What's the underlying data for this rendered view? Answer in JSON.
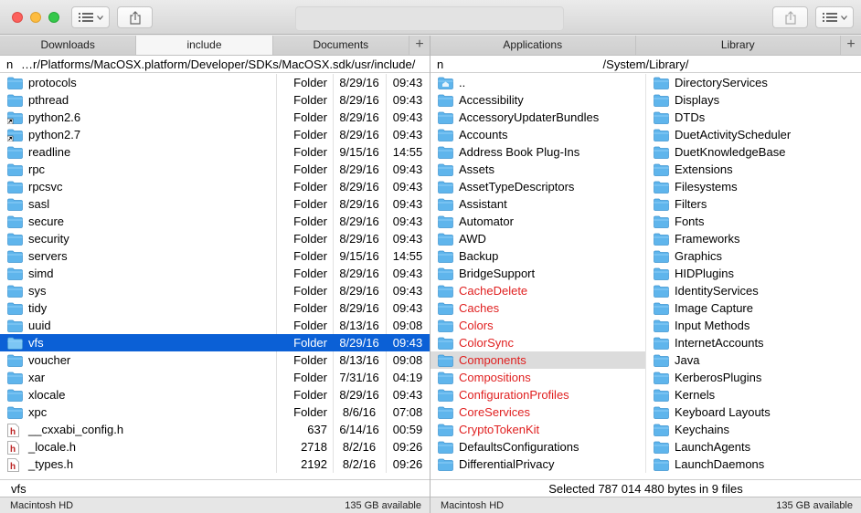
{
  "toolbar": {
    "list_view_icon": "list-view-icon",
    "share_icon": "share-icon"
  },
  "left": {
    "tabs": [
      {
        "label": "Downloads",
        "active": false
      },
      {
        "label": "include",
        "active": true
      },
      {
        "label": "Documents",
        "active": false
      }
    ],
    "add_tab": "+",
    "path_prefix": "n",
    "path": "…r/Platforms/MacOSX.platform/Developer/SDKs/MacOSX.sdk/usr/include/",
    "rows": [
      {
        "name": "protocols",
        "kind": "Folder",
        "date": "8/29/16",
        "time": "09:43",
        "icon": "folder"
      },
      {
        "name": "pthread",
        "kind": "Folder",
        "date": "8/29/16",
        "time": "09:43",
        "icon": "folder"
      },
      {
        "name": "python2.6",
        "kind": "Folder",
        "date": "8/29/16",
        "time": "09:43",
        "icon": "alias-folder"
      },
      {
        "name": "python2.7",
        "kind": "Folder",
        "date": "8/29/16",
        "time": "09:43",
        "icon": "alias-folder"
      },
      {
        "name": "readline",
        "kind": "Folder",
        "date": "9/15/16",
        "time": "14:55",
        "icon": "folder"
      },
      {
        "name": "rpc",
        "kind": "Folder",
        "date": "8/29/16",
        "time": "09:43",
        "icon": "folder"
      },
      {
        "name": "rpcsvc",
        "kind": "Folder",
        "date": "8/29/16",
        "time": "09:43",
        "icon": "folder"
      },
      {
        "name": "sasl",
        "kind": "Folder",
        "date": "8/29/16",
        "time": "09:43",
        "icon": "folder"
      },
      {
        "name": "secure",
        "kind": "Folder",
        "date": "8/29/16",
        "time": "09:43",
        "icon": "folder"
      },
      {
        "name": "security",
        "kind": "Folder",
        "date": "8/29/16",
        "time": "09:43",
        "icon": "folder"
      },
      {
        "name": "servers",
        "kind": "Folder",
        "date": "9/15/16",
        "time": "14:55",
        "icon": "folder"
      },
      {
        "name": "simd",
        "kind": "Folder",
        "date": "8/29/16",
        "time": "09:43",
        "icon": "folder"
      },
      {
        "name": "sys",
        "kind": "Folder",
        "date": "8/29/16",
        "time": "09:43",
        "icon": "folder"
      },
      {
        "name": "tidy",
        "kind": "Folder",
        "date": "8/29/16",
        "time": "09:43",
        "icon": "folder"
      },
      {
        "name": "uuid",
        "kind": "Folder",
        "date": "8/13/16",
        "time": "09:08",
        "icon": "folder"
      },
      {
        "name": "vfs",
        "kind": "Folder",
        "date": "8/29/16",
        "time": "09:43",
        "icon": "folder",
        "selected": true
      },
      {
        "name": "voucher",
        "kind": "Folder",
        "date": "8/13/16",
        "time": "09:08",
        "icon": "folder"
      },
      {
        "name": "xar",
        "kind": "Folder",
        "date": "7/31/16",
        "time": "04:19",
        "icon": "folder"
      },
      {
        "name": "xlocale",
        "kind": "Folder",
        "date": "8/29/16",
        "time": "09:43",
        "icon": "folder"
      },
      {
        "name": "xpc",
        "kind": "Folder",
        "date": "8/6/16",
        "time": "07:08",
        "icon": "folder"
      },
      {
        "name": "__cxxabi_config.h",
        "kind": "637",
        "date": "6/14/16",
        "time": "00:59",
        "icon": "header-file"
      },
      {
        "name": "_locale.h",
        "kind": "2718",
        "date": "8/2/16",
        "time": "09:26",
        "icon": "header-file"
      },
      {
        "name": "_types.h",
        "kind": "2192",
        "date": "8/2/16",
        "time": "09:26",
        "icon": "header-file"
      }
    ],
    "footer": "vfs",
    "status_volume": "Macintosh HD",
    "status_free": "135 GB available"
  },
  "right": {
    "tabs": [
      {
        "label": "Applications",
        "active": false
      },
      {
        "label": "Library",
        "active": false
      }
    ],
    "add_tab": "+",
    "path_prefix": "n",
    "path": "/System/Library/",
    "column_a": [
      {
        "name": "..",
        "icon": "parent-folder",
        "red": false
      },
      {
        "name": "Accessibility",
        "red": false
      },
      {
        "name": "AccessoryUpdaterBundles",
        "red": false
      },
      {
        "name": "Accounts",
        "red": false
      },
      {
        "name": "Address Book Plug-Ins",
        "red": false
      },
      {
        "name": "Assets",
        "red": false
      },
      {
        "name": "AssetTypeDescriptors",
        "red": false
      },
      {
        "name": "Assistant",
        "red": false
      },
      {
        "name": "Automator",
        "red": false
      },
      {
        "name": "AWD",
        "red": false
      },
      {
        "name": "Backup",
        "red": false
      },
      {
        "name": "BridgeSupport",
        "red": false
      },
      {
        "name": "CacheDelete",
        "red": true
      },
      {
        "name": "Caches",
        "red": true
      },
      {
        "name": "Colors",
        "red": true
      },
      {
        "name": "ColorSync",
        "red": true
      },
      {
        "name": "Components",
        "red": true,
        "highlight": true
      },
      {
        "name": "Compositions",
        "red": true
      },
      {
        "name": "ConfigurationProfiles",
        "red": true
      },
      {
        "name": "CoreServices",
        "red": true
      },
      {
        "name": "CryptoTokenKit",
        "red": true
      },
      {
        "name": "DefaultsConfigurations",
        "red": false
      },
      {
        "name": "DifferentialPrivacy",
        "red": false
      }
    ],
    "column_b": [
      {
        "name": "DirectoryServices"
      },
      {
        "name": "Displays"
      },
      {
        "name": "DTDs"
      },
      {
        "name": "DuetActivityScheduler"
      },
      {
        "name": "DuetKnowledgeBase"
      },
      {
        "name": "Extensions"
      },
      {
        "name": "Filesystems"
      },
      {
        "name": "Filters"
      },
      {
        "name": "Fonts"
      },
      {
        "name": "Frameworks"
      },
      {
        "name": "Graphics"
      },
      {
        "name": "HIDPlugins"
      },
      {
        "name": "IdentityServices"
      },
      {
        "name": "Image Capture"
      },
      {
        "name": "Input Methods"
      },
      {
        "name": "InternetAccounts"
      },
      {
        "name": "Java"
      },
      {
        "name": "KerberosPlugins"
      },
      {
        "name": "Kernels"
      },
      {
        "name": "Keyboard Layouts"
      },
      {
        "name": "Keychains"
      },
      {
        "name": "LaunchAgents"
      },
      {
        "name": "LaunchDaemons"
      }
    ],
    "footer": "Selected 787 014 480 bytes in 9 files",
    "status_volume": "Macintosh HD",
    "status_free": "135 GB available"
  },
  "colors": {
    "selection": "#0b60d6",
    "folder": "#5fb5ec",
    "red_text": "#e02020"
  }
}
